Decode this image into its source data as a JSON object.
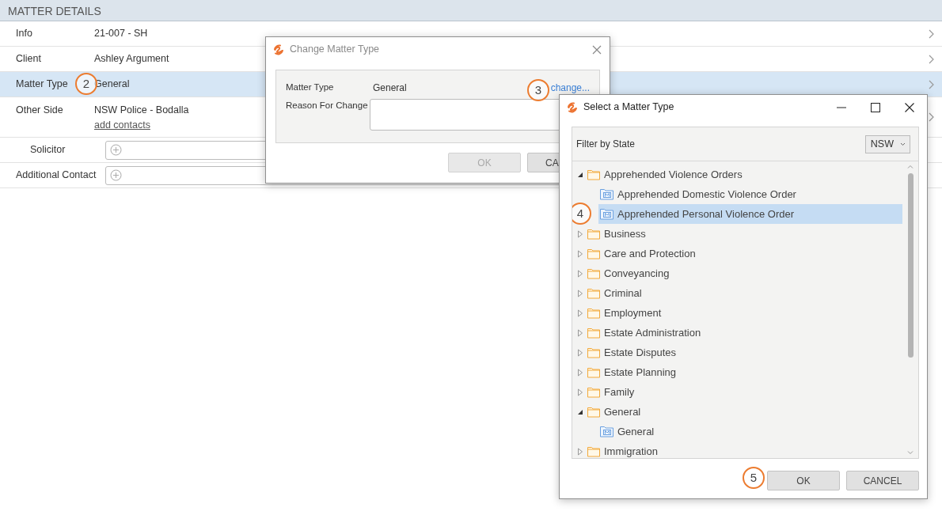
{
  "page": {
    "title": "MATTER DETAILS"
  },
  "fields": [
    {
      "kind": "text",
      "label": "Info",
      "value": "21-007 - SH",
      "selected": false
    },
    {
      "kind": "text",
      "label": "Client",
      "value": "Ashley Argument",
      "selected": false
    },
    {
      "kind": "text",
      "label": "Matter Type",
      "value": "General",
      "selected": true,
      "callout": "2"
    },
    {
      "kind": "text",
      "label": "Other Side",
      "value": "NSW Police - Bodalla",
      "link": "add contacts",
      "selected": false,
      "children": [
        {
          "kind": "add",
          "label": "Solicitor"
        }
      ]
    },
    {
      "kind": "add",
      "label": "Additional Contact"
    }
  ],
  "change_dialog": {
    "title": "Change Matter Type",
    "matter_type": {
      "label": "Matter Type",
      "value": "General",
      "link": "change...",
      "callout": "3"
    },
    "reason": {
      "label": "Reason For Change"
    },
    "buttons": [
      {
        "label": "OK",
        "disabled": true
      },
      {
        "label": "CA",
        "disabled": false
      }
    ]
  },
  "select_dialog": {
    "title": "Select a Matter Type",
    "filter": {
      "label": "Filter by State",
      "value": "NSW"
    },
    "tree": [
      {
        "kind": "folder",
        "label": "Apprehended Violence Orders",
        "expanded": true,
        "selected": false,
        "children": [
          {
            "kind": "type",
            "label": "Apprehended Domestic Violence Order",
            "selected": false
          },
          {
            "kind": "type",
            "label": "Apprehended Personal Violence Order",
            "selected": true,
            "callout": "4"
          }
        ]
      },
      {
        "kind": "folder",
        "label": "Business",
        "expanded": false,
        "selected": false
      },
      {
        "kind": "folder",
        "label": "Care and Protection",
        "expanded": false,
        "selected": false
      },
      {
        "kind": "folder",
        "label": "Conveyancing",
        "expanded": false,
        "selected": false
      },
      {
        "kind": "folder",
        "label": "Criminal",
        "expanded": false,
        "selected": false
      },
      {
        "kind": "folder",
        "label": "Employment",
        "expanded": false,
        "selected": false
      },
      {
        "kind": "folder",
        "label": "Estate Administration",
        "expanded": false,
        "selected": false
      },
      {
        "kind": "folder",
        "label": "Estate Disputes",
        "expanded": false,
        "selected": false
      },
      {
        "kind": "folder",
        "label": "Estate Planning",
        "expanded": false,
        "selected": false
      },
      {
        "kind": "folder",
        "label": "Family",
        "expanded": false,
        "selected": false
      },
      {
        "kind": "folder",
        "label": "General",
        "expanded": true,
        "selected": false,
        "children": [
          {
            "kind": "type",
            "label": "General",
            "selected": false
          }
        ]
      },
      {
        "kind": "folder",
        "label": "Immigration",
        "expanded": false,
        "selected": false
      }
    ],
    "buttons_callout": "5",
    "buttons": [
      {
        "label": "OK",
        "disabled": false
      },
      {
        "label": "CANCEL",
        "disabled": false
      }
    ]
  }
}
